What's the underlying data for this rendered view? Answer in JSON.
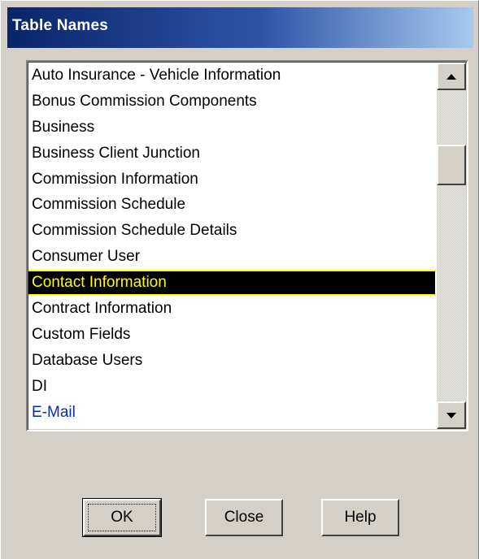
{
  "window": {
    "title": "Table Names"
  },
  "list": {
    "items": [
      {
        "label": "Auto Insurance - Vehicle Information",
        "selected": false
      },
      {
        "label": "Bonus Commission Components",
        "selected": false
      },
      {
        "label": "Business",
        "selected": false
      },
      {
        "label": "Business Client Junction",
        "selected": false
      },
      {
        "label": "Commission Information",
        "selected": false
      },
      {
        "label": "Commission Schedule",
        "selected": false
      },
      {
        "label": "Commission Schedule Details",
        "selected": false
      },
      {
        "label": "Consumer User",
        "selected": false
      },
      {
        "label": "Contact Information",
        "selected": true
      },
      {
        "label": "Contract Information",
        "selected": false
      },
      {
        "label": "Custom Fields",
        "selected": false
      },
      {
        "label": "Database Users",
        "selected": false
      },
      {
        "label": "DI",
        "selected": false
      },
      {
        "label": "E-Mail",
        "selected": false
      }
    ],
    "selected_label": "Contact Information",
    "selection_colors": {
      "background": "#000000",
      "text": "#ffff00"
    },
    "scroll_position": 0.2
  },
  "buttons": {
    "ok_label": "OK",
    "close_label": "Close",
    "help_label": "Help"
  },
  "icons": {
    "scroll_up": "up-arrow-icon",
    "scroll_down": "down-arrow-icon"
  }
}
